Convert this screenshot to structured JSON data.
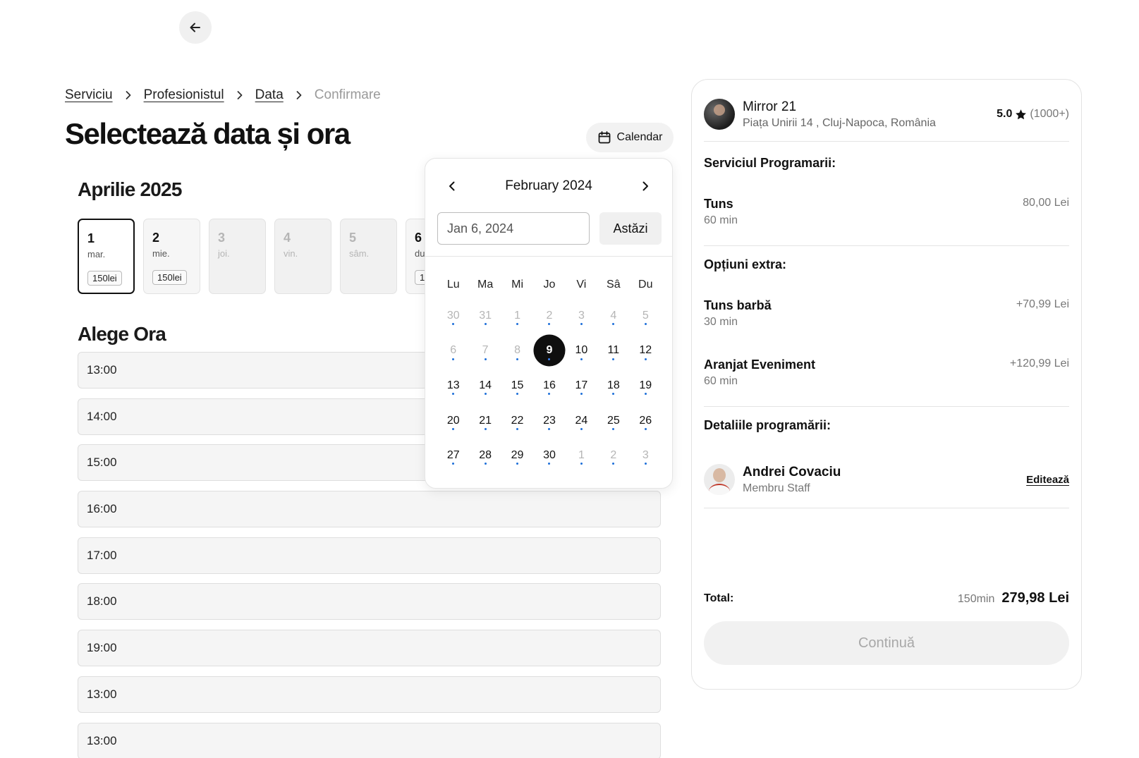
{
  "breadcrumb": [
    {
      "label": "Serviciu",
      "current": false
    },
    {
      "label": "Profesionistul",
      "current": false
    },
    {
      "label": "Data",
      "current": false
    },
    {
      "label": "Confirmare",
      "current": true
    }
  ],
  "page_title": "Selectează data și ora",
  "calendar_button": {
    "label": "Calendar"
  },
  "month_title": "Aprilie 2025",
  "days": [
    {
      "num": "1",
      "name": "mar.",
      "price": "150lei",
      "state": "active"
    },
    {
      "num": "2",
      "name": "mie.",
      "price": "150lei",
      "state": "available"
    },
    {
      "num": "3",
      "name": "joi.",
      "price": "",
      "state": "disabled"
    },
    {
      "num": "4",
      "name": "vin.",
      "price": "",
      "state": "disabled"
    },
    {
      "num": "5",
      "name": "sâm.",
      "price": "",
      "state": "disabled"
    },
    {
      "num": "6",
      "name": "dum.",
      "price": "150lei",
      "state": "available"
    }
  ],
  "hours_title": "Alege Ora",
  "slots": [
    "13:00",
    "14:00",
    "15:00",
    "16:00",
    "17:00",
    "18:00",
    "19:00",
    "13:00",
    "13:00"
  ],
  "datepicker": {
    "month_label": "February 2024",
    "input_value": "Jan 6, 2024",
    "today_label": "Astăzi",
    "weekdays": [
      "Lu",
      "Ma",
      "Mi",
      "Jo",
      "Vi",
      "Sâ",
      "Du"
    ],
    "dot_color": "#1e6fd9",
    "weeks": [
      [
        {
          "d": "30",
          "m": true
        },
        {
          "d": "31",
          "m": true
        },
        {
          "d": "1",
          "m": true
        },
        {
          "d": "2",
          "m": true
        },
        {
          "d": "3",
          "m": true
        },
        {
          "d": "4",
          "m": true
        },
        {
          "d": "5",
          "m": true
        }
      ],
      [
        {
          "d": "6",
          "m": true
        },
        {
          "d": "7",
          "m": true
        },
        {
          "d": "8",
          "m": true
        },
        {
          "d": "9",
          "sel": true
        },
        {
          "d": "10"
        },
        {
          "d": "11"
        },
        {
          "d": "12"
        }
      ],
      [
        {
          "d": "13"
        },
        {
          "d": "14"
        },
        {
          "d": "15"
        },
        {
          "d": "16"
        },
        {
          "d": "17"
        },
        {
          "d": "18"
        },
        {
          "d": "19"
        }
      ],
      [
        {
          "d": "20"
        },
        {
          "d": "21"
        },
        {
          "d": "22"
        },
        {
          "d": "23"
        },
        {
          "d": "24"
        },
        {
          "d": "25"
        },
        {
          "d": "26"
        }
      ],
      [
        {
          "d": "27"
        },
        {
          "d": "28"
        },
        {
          "d": "29"
        },
        {
          "d": "30"
        },
        {
          "d": "1",
          "m": true
        },
        {
          "d": "2",
          "m": true
        },
        {
          "d": "3",
          "m": true
        }
      ]
    ]
  },
  "summary": {
    "shop": {
      "name": "Mirror 21",
      "address": "Piața Unirii 14 , Cluj-Napoca, România",
      "rating": "5.0",
      "rating_count": "(1000+)"
    },
    "service_title": "Serviciul Programarii:",
    "service": {
      "name": "Tuns",
      "duration": "60 min",
      "price": "80,00 Lei"
    },
    "extras_title": "Opțiuni extra:",
    "extras": [
      {
        "name": "Tuns barbă",
        "duration": "30 min",
        "price": "+70,99 Lei"
      },
      {
        "name": "Aranjat Eveniment",
        "duration": "60 min",
        "price": "+120,99 Lei"
      }
    ],
    "details_title": "Detaliile programării:",
    "staff": {
      "name": "Andrei Covaciu",
      "role": "Membru Staff",
      "edit_label": "Editează"
    },
    "total_label": "Total:",
    "total_duration": "150min",
    "total_price": "279,98 Lei",
    "continue_label": "Continuă"
  }
}
